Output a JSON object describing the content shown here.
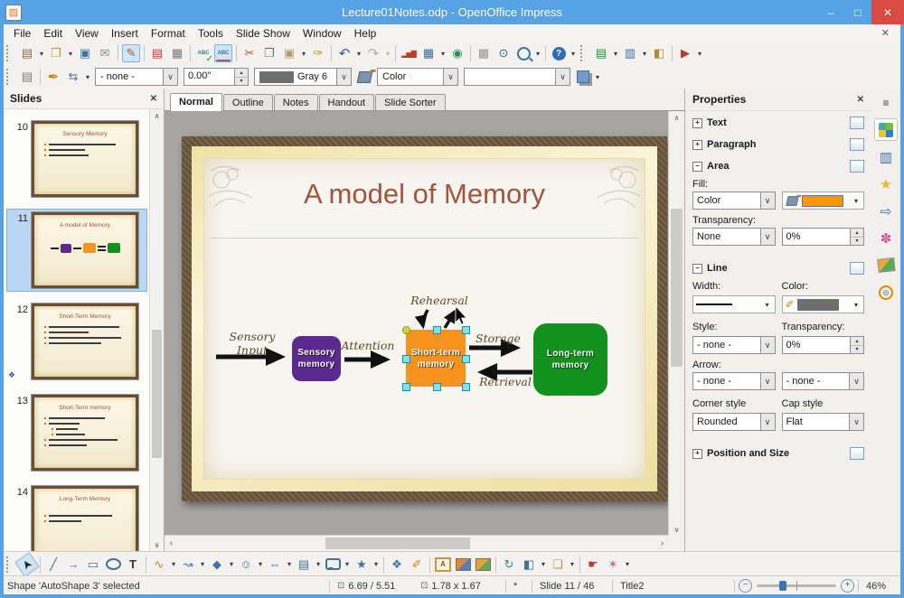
{
  "window": {
    "title": "Lecture01Notes.odp - OpenOffice Impress"
  },
  "menubar": {
    "items": [
      "File",
      "Edit",
      "View",
      "Insert",
      "Format",
      "Tools",
      "Slide Show",
      "Window",
      "Help"
    ]
  },
  "toolbar_line_filling": {
    "line_style": "- none -",
    "line_width": "0.00\"",
    "line_color_name": "Gray 6",
    "fill_type": "Color",
    "fill_color_name": "",
    "colors": {
      "line_swatch": "#6e6e6e",
      "fill_swatch": "#ff9800"
    }
  },
  "view_tabs": {
    "items": [
      "Normal",
      "Outline",
      "Notes",
      "Handout",
      "Slide Sorter"
    ],
    "active": "Normal"
  },
  "slides_panel": {
    "title": "Slides",
    "slides": [
      {
        "number": "10",
        "title": "Sensory Memory"
      },
      {
        "number": "11",
        "title": "A model of Memory"
      },
      {
        "number": "12",
        "title": "Short-Term Memory"
      },
      {
        "number": "13",
        "title": "Short-Term memory"
      },
      {
        "number": "14",
        "title": "Long-Term Memory"
      }
    ]
  },
  "slide": {
    "title": "A model of Memory",
    "nodes": {
      "sensory": {
        "label": "Sensory memory",
        "color": "#5b2a90"
      },
      "short": {
        "label": "Short-term memory",
        "color": "#f6921e"
      },
      "long": {
        "label": "Long-term memory",
        "color": "#12911e"
      }
    },
    "labels": {
      "rehearsal": "Rehearsal",
      "sensory_input": "Sensory Input",
      "attention": "Attention",
      "storage": "Storage",
      "retrieval": "Retrieval"
    }
  },
  "properties": {
    "title": "Properties",
    "text_section": "Text",
    "paragraph_section": "Paragraph",
    "area": {
      "section": "Area",
      "fill_label": "Fill:",
      "fill_type": "Color",
      "fill_swatch": "#ff9800",
      "transparency_label": "Transparency:",
      "transparency_type": "None",
      "transparency_value": "0%"
    },
    "line": {
      "section": "Line",
      "width_label": "Width:",
      "color_label": "Color:",
      "line_swatch": "#6e6e6e",
      "style_label": "Style:",
      "style_value": "- none -",
      "transparency_label": "Transparency:",
      "transparency_value": "0%",
      "arrow_label": "Arrow:",
      "arrow_start": "- none -",
      "arrow_end": "- none -",
      "corner_label": "Corner style",
      "corner_value": "Rounded",
      "cap_label": "Cap style",
      "cap_value": "Flat"
    },
    "possize_section": "Position and Size"
  },
  "statusbar": {
    "selection": "Shape 'AutoShape 3' selected",
    "position": "6.69 / 5.51",
    "size": "1.78 x 1.67",
    "modified": "*",
    "slide": "Slide 11 / 46",
    "layout": "Title2",
    "zoom": "46%"
  },
  "glyphs": {
    "app": "▧",
    "win_min": "–",
    "win_max": "□",
    "win_close": "✕",
    "menubar_close": "✕",
    "new": "▤",
    "open": "❒",
    "save": "▣",
    "email": "✉",
    "edit_file": "✎",
    "pdf": "▤",
    "print": "▦",
    "spell_abc": "ABC",
    "check": "✓",
    "cut": "✂",
    "copy": "❐",
    "paste": "▣",
    "brush": "✑",
    "undo": "↶",
    "redo": "↷",
    "chart": "▂▅▇",
    "table": "▦",
    "globe": "◉",
    "grid": "▩",
    "compass": "⊙",
    "help": "?",
    "new_slide": "▤",
    "slide_layout": "▥",
    "slide_design": "◧",
    "start_show": "▶",
    "styles": "▤",
    "line_dialog": "✒",
    "arrow_style": "⇆",
    "dd": "∨",
    "spin_up": "▴",
    "spin_down": "▾",
    "overflow": "▾",
    "pm_plus": "+",
    "pm_minus": "−",
    "pointer": "➤",
    "line": "╱",
    "arrow": "→",
    "rect": "▭",
    "text": "T",
    "curve": "∿",
    "connector": "↝",
    "diamond": "◆",
    "smiley": "☺",
    "block_arrow": "⇔",
    "flowchart": "▤",
    "star": "★",
    "points": "❖",
    "glue": "✐",
    "fontwork": "A",
    "rotate": "↻",
    "align": "◧",
    "arrange": "❏",
    "interaction": "☛",
    "anim": "✶",
    "sb_menu": "≡",
    "sb_master": "▥",
    "sb_star": "★",
    "sb_transition": "⇨",
    "sb_effects": "✽",
    "sb_navigator": "◎",
    "pos_icon": "⊡",
    "size_icon": "⊡",
    "zoom_minus": "−",
    "zoom_plus": "+",
    "panel_up": "∧",
    "panel_down": "∨",
    "sc_left": "‹",
    "sc_right": "›",
    "anim_star": "❖"
  }
}
